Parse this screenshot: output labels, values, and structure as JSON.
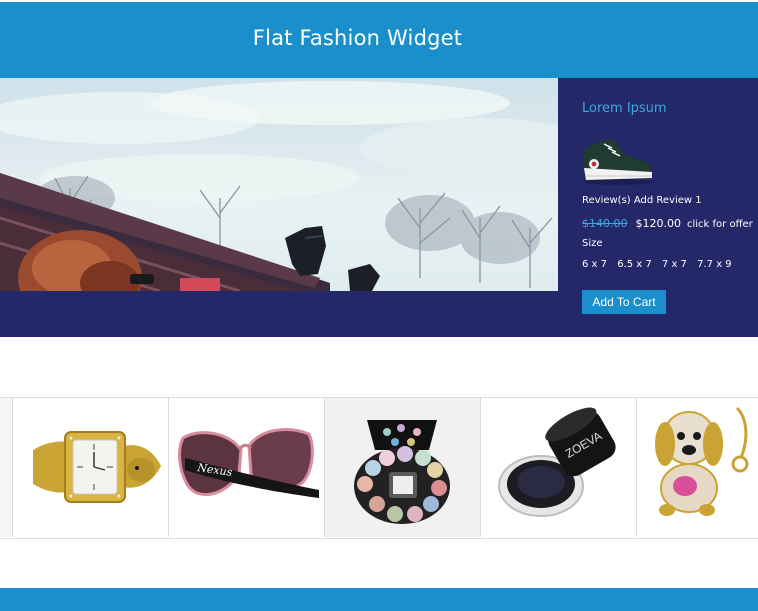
{
  "header": {
    "title": "Flat Fashion Widget"
  },
  "product": {
    "title": "Lorem Ipsum",
    "reviews": "Review(s) Add Review 1",
    "old_price": "$140.00",
    "new_price": "$120.00",
    "offer": "click for offer",
    "size_label": "Size",
    "sizes": [
      "6 x 7",
      "6.5 x 7",
      "7 x 7",
      "7.7 x 9"
    ],
    "cart_label": "Add To Cart"
  },
  "carousel": {
    "items": [
      {
        "icon": "gold-watch"
      },
      {
        "icon": "sunglasses",
        "brand": "Nexus"
      },
      {
        "icon": "makeup-palette"
      },
      {
        "icon": "gel-eyeliner-jar",
        "brand": "ZOEVA"
      },
      {
        "icon": "jeweled-dog-keychain"
      }
    ]
  },
  "colors": {
    "primary": "#1a8fcb",
    "navy": "#252868",
    "accent_text": "#3aa9de"
  }
}
